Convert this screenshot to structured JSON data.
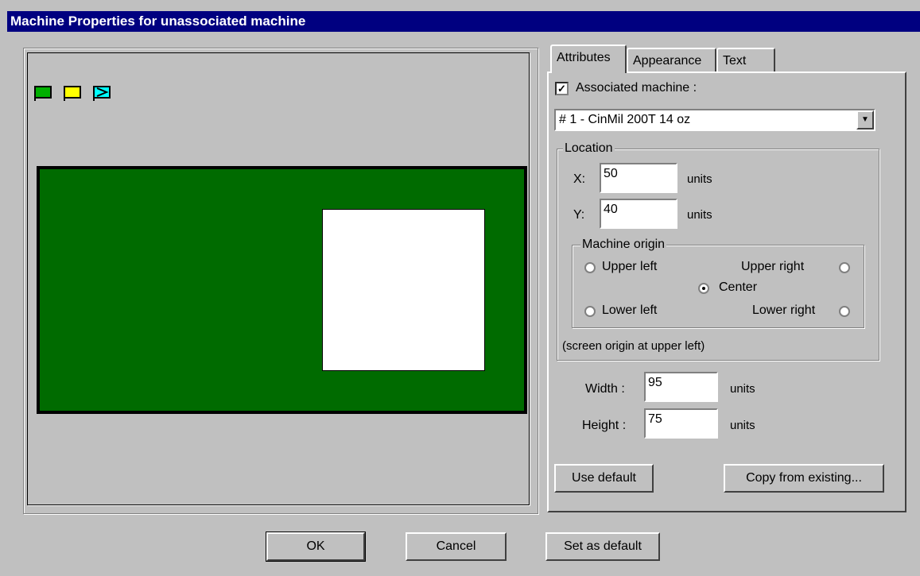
{
  "window": {
    "title": "Machine Properties for unassociated machine"
  },
  "preview": {
    "flag_colors": [
      "#00b000",
      "#ffff00",
      "#00ffff"
    ],
    "machine_color": "#006b00"
  },
  "tabs": [
    {
      "label": "Attributes"
    },
    {
      "label": "Appearance"
    },
    {
      "label": "Text"
    }
  ],
  "attributes": {
    "associated_label": "Associated machine :",
    "associated_checked": "✓",
    "machine_selected": "# 1 - CinMil    200T 14 oz",
    "location": {
      "title": "Location",
      "x_label": "X:",
      "x_value": "50",
      "y_label": "Y:",
      "y_value": "40",
      "units": "units"
    },
    "origin": {
      "title": "Machine origin",
      "upper_left": "Upper left",
      "upper_right": "Upper right",
      "center": "Center",
      "lower_left": "Lower left",
      "lower_right": "Lower right",
      "selected": "Center"
    },
    "screen_note": "(screen origin at upper left)",
    "width_label": "Width :",
    "width_value": "95",
    "height_label": "Height :",
    "height_value": "75",
    "units": "units",
    "use_default": "Use default",
    "copy_existing": "Copy from existing..."
  },
  "buttons": {
    "ok": "OK",
    "cancel": "Cancel",
    "set_default": "Set as default"
  }
}
